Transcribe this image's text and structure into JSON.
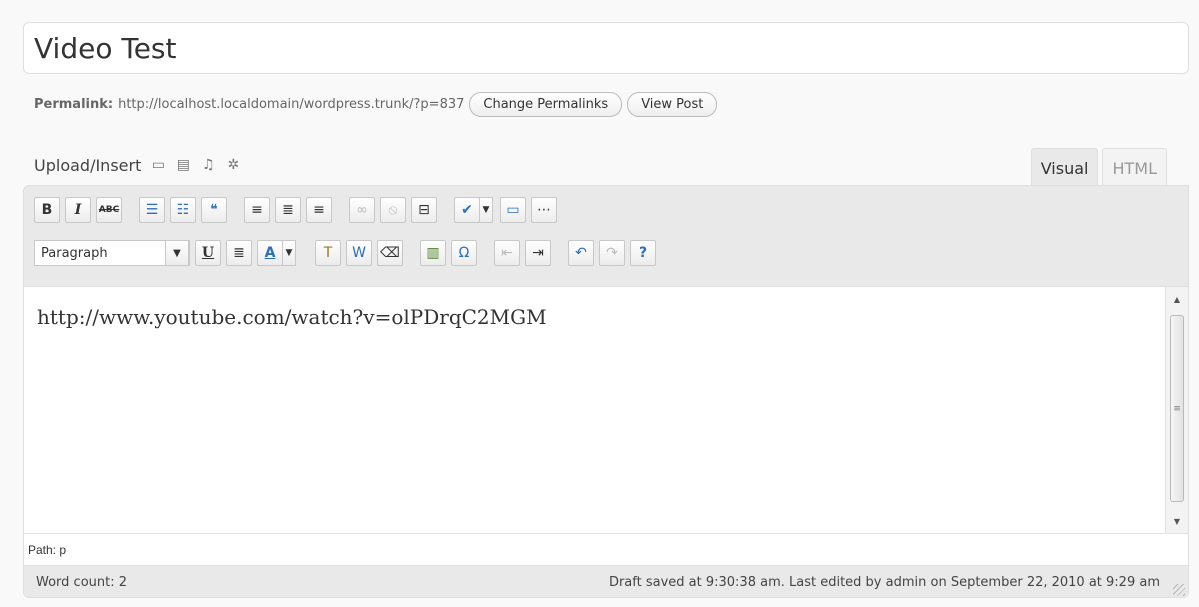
{
  "post": {
    "title": "Video Test",
    "permalink_label": "Permalink:",
    "permalink_url": "http://localhost.localdomain/wordpress.trunk/?p=837",
    "change_permalinks_label": "Change Permalinks",
    "view_post_label": "View Post"
  },
  "media": {
    "upload_insert_label": "Upload/Insert",
    "icons": [
      "image-icon",
      "video-icon",
      "audio-icon",
      "media-icon"
    ]
  },
  "tabs": [
    {
      "label": "Visual",
      "active": true
    },
    {
      "label": "HTML",
      "active": false
    }
  ],
  "toolbar": {
    "row1": [
      {
        "name": "bold",
        "glyph": "B"
      },
      {
        "name": "italic",
        "glyph": "I"
      },
      {
        "name": "strikethrough",
        "glyph": "ABC"
      },
      {
        "name": "unordered-list",
        "glyph": "☰"
      },
      {
        "name": "ordered-list",
        "glyph": "☷"
      },
      {
        "name": "blockquote",
        "glyph": "❝"
      },
      {
        "name": "align-left",
        "glyph": "≡"
      },
      {
        "name": "align-center",
        "glyph": "≣"
      },
      {
        "name": "align-right",
        "glyph": "≡"
      },
      {
        "name": "link",
        "glyph": "∞"
      },
      {
        "name": "unlink",
        "glyph": "⦸"
      },
      {
        "name": "more-tag",
        "glyph": "⊟"
      },
      {
        "name": "spellcheck",
        "glyph": "✔"
      },
      {
        "name": "fullscreen",
        "glyph": "▭"
      },
      {
        "name": "kitchen-sink",
        "glyph": "⋯"
      }
    ],
    "row2": [
      {
        "name": "underline",
        "glyph": "U"
      },
      {
        "name": "justify",
        "glyph": "≣"
      },
      {
        "name": "text-color",
        "glyph": "A"
      },
      {
        "name": "paste-text",
        "glyph": "T"
      },
      {
        "name": "paste-word",
        "glyph": "W"
      },
      {
        "name": "remove-format",
        "glyph": "⌫"
      },
      {
        "name": "insert-media",
        "glyph": "▥"
      },
      {
        "name": "special-char",
        "glyph": "Ω"
      },
      {
        "name": "outdent",
        "glyph": "⇤"
      },
      {
        "name": "indent",
        "glyph": "⇥"
      },
      {
        "name": "undo",
        "glyph": "↶"
      },
      {
        "name": "redo",
        "glyph": "↷"
      },
      {
        "name": "help",
        "glyph": "?"
      }
    ],
    "format_select": "Paragraph"
  },
  "editor": {
    "content": "http://www.youtube.com/watch?v=olPDrqC2MGM",
    "path": "Path: p"
  },
  "status": {
    "word_count": "Word count: 2",
    "draft_saved": "Draft saved at 9:30:38 am. Last edited by admin on September 22, 2010 at 9:29 am"
  },
  "colors": {
    "toolbar_bg": "#e9e9e9",
    "blue_icon": "#2c6ebd"
  }
}
